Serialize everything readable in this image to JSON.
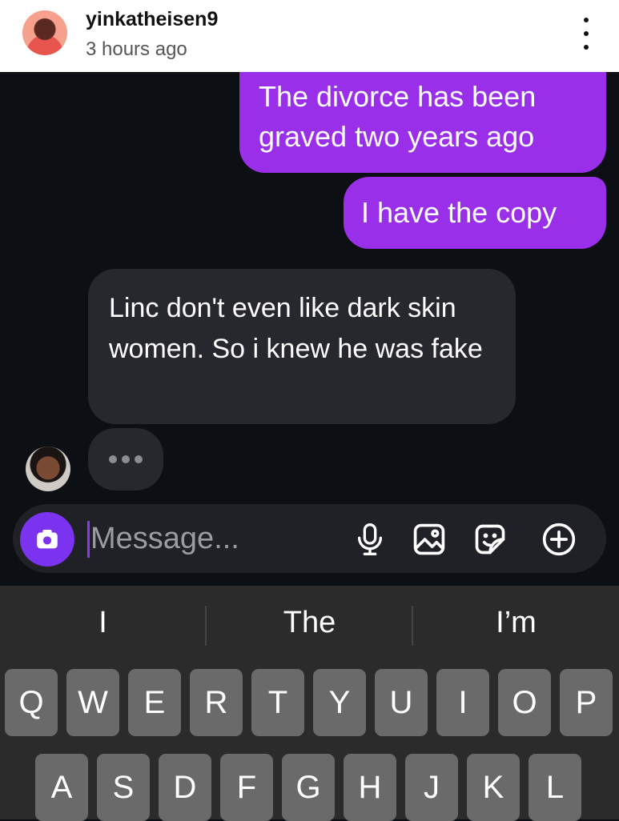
{
  "header": {
    "username": "yinkatheisen9",
    "timestamp": "3 hours ago",
    "more_icon": "more-vertical-icon"
  },
  "messages": [
    {
      "direction": "sent",
      "text": "The divorce has been graved two years ago"
    },
    {
      "direction": "sent",
      "text": "I have the copy"
    },
    {
      "direction": "received",
      "text": "Linc  don't  even like dark skin women. So i knew he was fake"
    }
  ],
  "typing_indicator": "typing-dots",
  "composer": {
    "placeholder": "Message...",
    "icons": [
      "camera-icon",
      "microphone-icon",
      "image-icon",
      "sticker-icon",
      "plus-circle-icon"
    ]
  },
  "keyboard": {
    "suggestions": [
      "I",
      "The",
      "I’m"
    ],
    "row1": [
      "Q",
      "W",
      "E",
      "R",
      "T",
      "Y",
      "U",
      "I",
      "O",
      "P"
    ],
    "row2": [
      "A",
      "S",
      "D",
      "F",
      "G",
      "H",
      "J",
      "K",
      "L"
    ]
  },
  "colors": {
    "sent_bubble": "#9a2fea",
    "received_bubble": "#26282e",
    "background": "#0c0f14",
    "accent": "#7b33f0"
  }
}
